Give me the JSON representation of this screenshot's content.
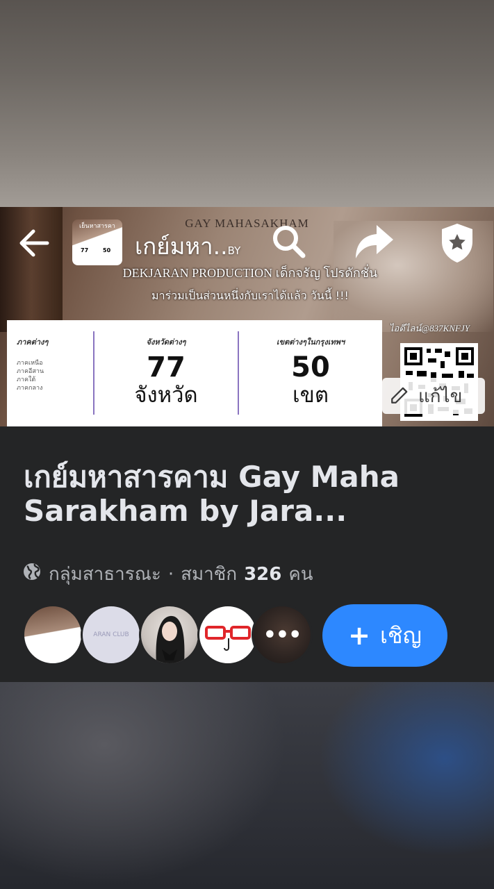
{
  "header": {
    "title": "เกย์มหา..",
    "title_suffix": "BY"
  },
  "cover": {
    "banner_title": "GAY MAHASAKHAM",
    "production": "DEKJARAN PRODUCTION เด็กจรัญ โปรดักชั่น",
    "join_text": "มาร่วมเป็นส่วนหนึ่งกับเราได้แล้ว วันนี้ !!!",
    "line_id": "ไอดีไลน์@837KNFJY",
    "regions_heading": "ภาคต่างๆ",
    "regions": [
      "ภาคเหนือ",
      "ภาคอีสาน",
      "ภาคใต้",
      "ภาคกลาง"
    ],
    "provinces_heading": "จังหวัดต่างๆ",
    "provinces_count": "77",
    "provinces_unit": "จังหวัด",
    "districts_heading": "เขตต่างๆในกรุงเทพฯ",
    "districts_count": "50",
    "districts_unit": "เขต",
    "edit_label": "แก้ไข"
  },
  "thumb": {
    "title": "เย็นหาสารคา",
    "num1": "77",
    "num2": "50"
  },
  "group": {
    "name": "เกย์มหาสารคาม Gay Maha Sarakham by Jara...",
    "privacy": "กลุ่มสาธารณะ",
    "separator": "·",
    "members_label": "สมาชิก",
    "member_count": "326",
    "members_unit": "คน"
  },
  "avatars": {
    "av2_text": "ARAN CLUB",
    "more_label": "•••"
  },
  "invite": {
    "plus": "+",
    "label": "เชิญ"
  },
  "colors": {
    "panel_bg": "#242526",
    "accent": "#2d88ff",
    "text_primary": "#e4e6eb",
    "text_secondary": "#b0b3b8"
  },
  "icons": [
    "back-arrow-icon",
    "search-icon",
    "share-icon",
    "admin-shield-icon",
    "pencil-icon",
    "globe-icon"
  ]
}
